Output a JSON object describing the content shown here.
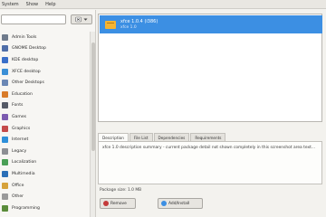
{
  "menubar": {
    "items": [
      "System",
      "Show",
      "Help"
    ]
  },
  "search": {
    "placeholder": "",
    "value": ""
  },
  "categories": [
    {
      "label": "Admin Tools",
      "color": "#6f7b8c"
    },
    {
      "label": "GNOME Desktop",
      "color": "#4f6ea8"
    },
    {
      "label": "KDE desktop",
      "color": "#3a6fc9"
    },
    {
      "label": "XFCE desktop",
      "color": "#3b8fd6"
    },
    {
      "label": "Other Desktops",
      "color": "#6a87b4"
    },
    {
      "label": "Education",
      "color": "#d97c2a"
    },
    {
      "label": "Fonts",
      "color": "#555a66"
    },
    {
      "label": "Games",
      "color": "#7c5bb0"
    },
    {
      "label": "Graphics",
      "color": "#c44a4a"
    },
    {
      "label": "Internet",
      "color": "#2f8fd9"
    },
    {
      "label": "Legacy",
      "color": "#8d8f94"
    },
    {
      "label": "Localization",
      "color": "#4a9f56"
    },
    {
      "label": "Multimedia",
      "color": "#2b6fb7"
    },
    {
      "label": "Office",
      "color": "#d6a23a"
    },
    {
      "label": "Other",
      "color": "#9a9a9a"
    },
    {
      "label": "Programming",
      "color": "#5a8c3a"
    }
  ],
  "package": {
    "name": "xfce 1.0.4 (i386)",
    "summary": "xfce 1.0"
  },
  "tabs": [
    "Description",
    "File List",
    "Dependencies",
    "Requirements"
  ],
  "description": "xfce 1.0 description summary - current package detail not shown completely in this screenshot area text...",
  "download_size": "Package size: 1.0 MB",
  "buttons": {
    "remove": "Remove",
    "install": "Add/Install"
  },
  "colors": {
    "selection": "#3c8fe3",
    "remove_icon": "#c43b3b",
    "install_icon": "#3c8fe3"
  }
}
